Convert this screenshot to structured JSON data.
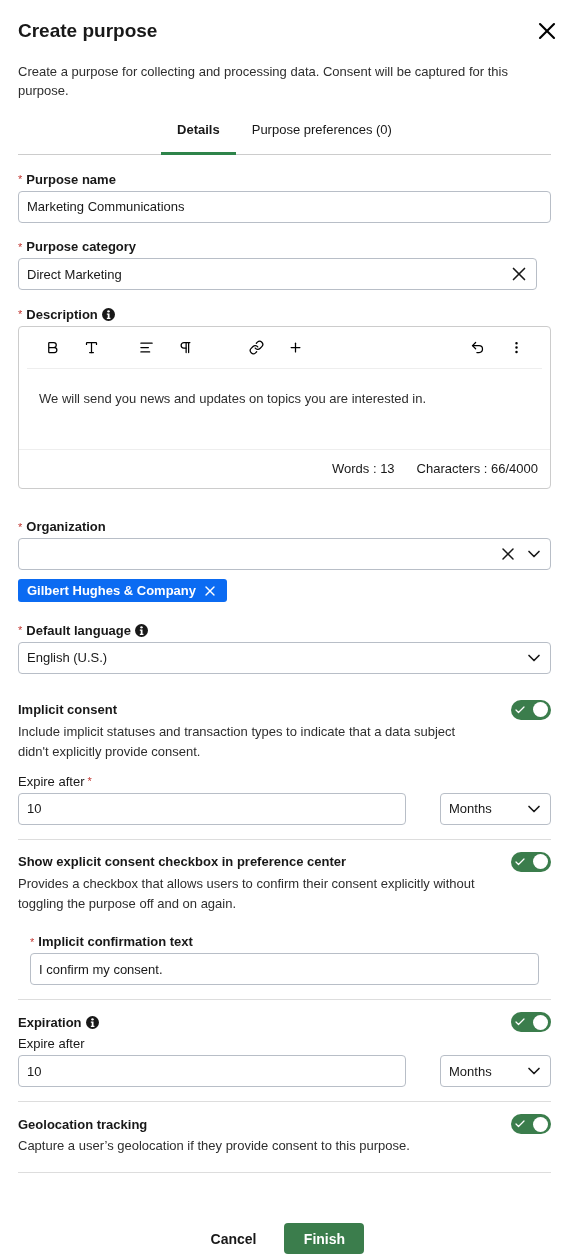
{
  "dialog": {
    "title": "Create purpose",
    "description": "Create a purpose for collecting and processing data. Consent will be captured for this purpose."
  },
  "required_mark": "*",
  "tabs": [
    {
      "label": "Details",
      "selected": true
    },
    {
      "label": "Purpose preferences (0)",
      "selected": false
    }
  ],
  "purpose_name": {
    "label": "Purpose name",
    "required": true,
    "value": "Marketing Communications"
  },
  "purpose_category": {
    "label": "Purpose category",
    "required": true,
    "value": "Direct Marketing"
  },
  "description": {
    "label": "Description",
    "required": true,
    "value": "We will send you news and updates on topics you are interested in.",
    "words": "Words : 13",
    "characters": "Characters : 66/4000"
  },
  "organization": {
    "label": "Organization",
    "required": true,
    "pills": [
      "Gilbert Hughes & Company"
    ]
  },
  "default_language": {
    "label": "Default language",
    "required": true,
    "value": "English (U.S.)"
  },
  "settings": [
    {
      "title": "Implicit consent",
      "info": false,
      "on": true,
      "text": "Include implicit statuses and transaction types to indicate that a data subject didn't explicitly provide consent.",
      "expire": {
        "label": "Expire after",
        "required": true,
        "value": "10",
        "unit": "Months"
      }
    },
    {
      "title": "Show explicit consent checkbox in preference center",
      "info": false,
      "on": true,
      "text": "Provides a checkbox that allows users to confirm their consent explicitly without toggling the purpose off and on again.",
      "confirmation": {
        "label": "Implicit confirmation text",
        "required": true,
        "value": "I confirm my consent."
      }
    },
    {
      "title": "Expiration",
      "info": true,
      "on": true,
      "expire": {
        "label": "Expire after",
        "required": false,
        "value": "10",
        "unit": "Months"
      }
    },
    {
      "title": "Geolocation tracking",
      "info": false,
      "on": true,
      "text": "Capture a user’s geolocation if they provide consent to this purpose."
    }
  ],
  "buttons": {
    "cancel": "Cancel",
    "finish": "Finish"
  }
}
